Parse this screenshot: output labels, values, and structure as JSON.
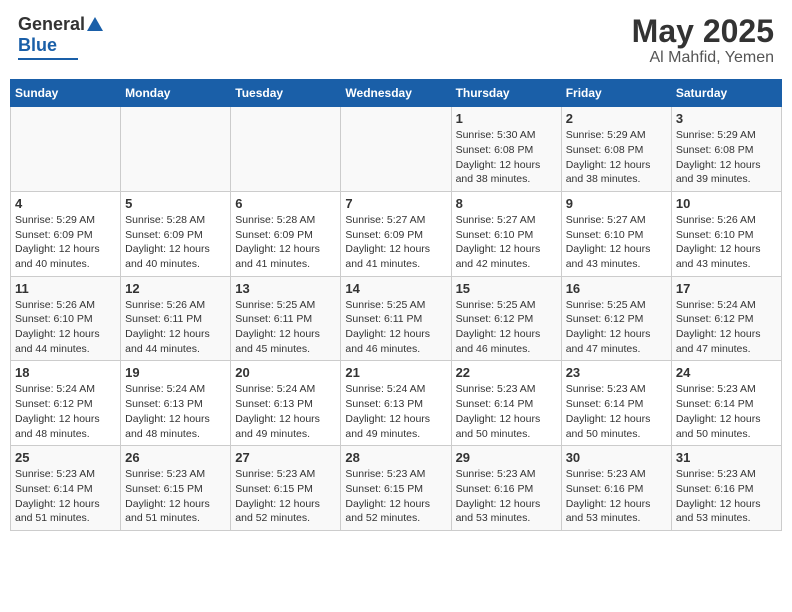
{
  "header": {
    "logo_general": "General",
    "logo_blue": "Blue",
    "month": "May 2025",
    "location": "Al Mahfid, Yemen"
  },
  "days_of_week": [
    "Sunday",
    "Monday",
    "Tuesday",
    "Wednesday",
    "Thursday",
    "Friday",
    "Saturday"
  ],
  "weeks": [
    [
      {
        "day": "",
        "info": ""
      },
      {
        "day": "",
        "info": ""
      },
      {
        "day": "",
        "info": ""
      },
      {
        "day": "",
        "info": ""
      },
      {
        "day": "1",
        "info": "Sunrise: 5:30 AM\nSunset: 6:08 PM\nDaylight: 12 hours\nand 38 minutes."
      },
      {
        "day": "2",
        "info": "Sunrise: 5:29 AM\nSunset: 6:08 PM\nDaylight: 12 hours\nand 38 minutes."
      },
      {
        "day": "3",
        "info": "Sunrise: 5:29 AM\nSunset: 6:08 PM\nDaylight: 12 hours\nand 39 minutes."
      }
    ],
    [
      {
        "day": "4",
        "info": "Sunrise: 5:29 AM\nSunset: 6:09 PM\nDaylight: 12 hours\nand 40 minutes."
      },
      {
        "day": "5",
        "info": "Sunrise: 5:28 AM\nSunset: 6:09 PM\nDaylight: 12 hours\nand 40 minutes."
      },
      {
        "day": "6",
        "info": "Sunrise: 5:28 AM\nSunset: 6:09 PM\nDaylight: 12 hours\nand 41 minutes."
      },
      {
        "day": "7",
        "info": "Sunrise: 5:27 AM\nSunset: 6:09 PM\nDaylight: 12 hours\nand 41 minutes."
      },
      {
        "day": "8",
        "info": "Sunrise: 5:27 AM\nSunset: 6:10 PM\nDaylight: 12 hours\nand 42 minutes."
      },
      {
        "day": "9",
        "info": "Sunrise: 5:27 AM\nSunset: 6:10 PM\nDaylight: 12 hours\nand 43 minutes."
      },
      {
        "day": "10",
        "info": "Sunrise: 5:26 AM\nSunset: 6:10 PM\nDaylight: 12 hours\nand 43 minutes."
      }
    ],
    [
      {
        "day": "11",
        "info": "Sunrise: 5:26 AM\nSunset: 6:10 PM\nDaylight: 12 hours\nand 44 minutes."
      },
      {
        "day": "12",
        "info": "Sunrise: 5:26 AM\nSunset: 6:11 PM\nDaylight: 12 hours\nand 44 minutes."
      },
      {
        "day": "13",
        "info": "Sunrise: 5:25 AM\nSunset: 6:11 PM\nDaylight: 12 hours\nand 45 minutes."
      },
      {
        "day": "14",
        "info": "Sunrise: 5:25 AM\nSunset: 6:11 PM\nDaylight: 12 hours\nand 46 minutes."
      },
      {
        "day": "15",
        "info": "Sunrise: 5:25 AM\nSunset: 6:12 PM\nDaylight: 12 hours\nand 46 minutes."
      },
      {
        "day": "16",
        "info": "Sunrise: 5:25 AM\nSunset: 6:12 PM\nDaylight: 12 hours\nand 47 minutes."
      },
      {
        "day": "17",
        "info": "Sunrise: 5:24 AM\nSunset: 6:12 PM\nDaylight: 12 hours\nand 47 minutes."
      }
    ],
    [
      {
        "day": "18",
        "info": "Sunrise: 5:24 AM\nSunset: 6:12 PM\nDaylight: 12 hours\nand 48 minutes."
      },
      {
        "day": "19",
        "info": "Sunrise: 5:24 AM\nSunset: 6:13 PM\nDaylight: 12 hours\nand 48 minutes."
      },
      {
        "day": "20",
        "info": "Sunrise: 5:24 AM\nSunset: 6:13 PM\nDaylight: 12 hours\nand 49 minutes."
      },
      {
        "day": "21",
        "info": "Sunrise: 5:24 AM\nSunset: 6:13 PM\nDaylight: 12 hours\nand 49 minutes."
      },
      {
        "day": "22",
        "info": "Sunrise: 5:23 AM\nSunset: 6:14 PM\nDaylight: 12 hours\nand 50 minutes."
      },
      {
        "day": "23",
        "info": "Sunrise: 5:23 AM\nSunset: 6:14 PM\nDaylight: 12 hours\nand 50 minutes."
      },
      {
        "day": "24",
        "info": "Sunrise: 5:23 AM\nSunset: 6:14 PM\nDaylight: 12 hours\nand 50 minutes."
      }
    ],
    [
      {
        "day": "25",
        "info": "Sunrise: 5:23 AM\nSunset: 6:14 PM\nDaylight: 12 hours\nand 51 minutes."
      },
      {
        "day": "26",
        "info": "Sunrise: 5:23 AM\nSunset: 6:15 PM\nDaylight: 12 hours\nand 51 minutes."
      },
      {
        "day": "27",
        "info": "Sunrise: 5:23 AM\nSunset: 6:15 PM\nDaylight: 12 hours\nand 52 minutes."
      },
      {
        "day": "28",
        "info": "Sunrise: 5:23 AM\nSunset: 6:15 PM\nDaylight: 12 hours\nand 52 minutes."
      },
      {
        "day": "29",
        "info": "Sunrise: 5:23 AM\nSunset: 6:16 PM\nDaylight: 12 hours\nand 53 minutes."
      },
      {
        "day": "30",
        "info": "Sunrise: 5:23 AM\nSunset: 6:16 PM\nDaylight: 12 hours\nand 53 minutes."
      },
      {
        "day": "31",
        "info": "Sunrise: 5:23 AM\nSunset: 6:16 PM\nDaylight: 12 hours\nand 53 minutes."
      }
    ]
  ]
}
